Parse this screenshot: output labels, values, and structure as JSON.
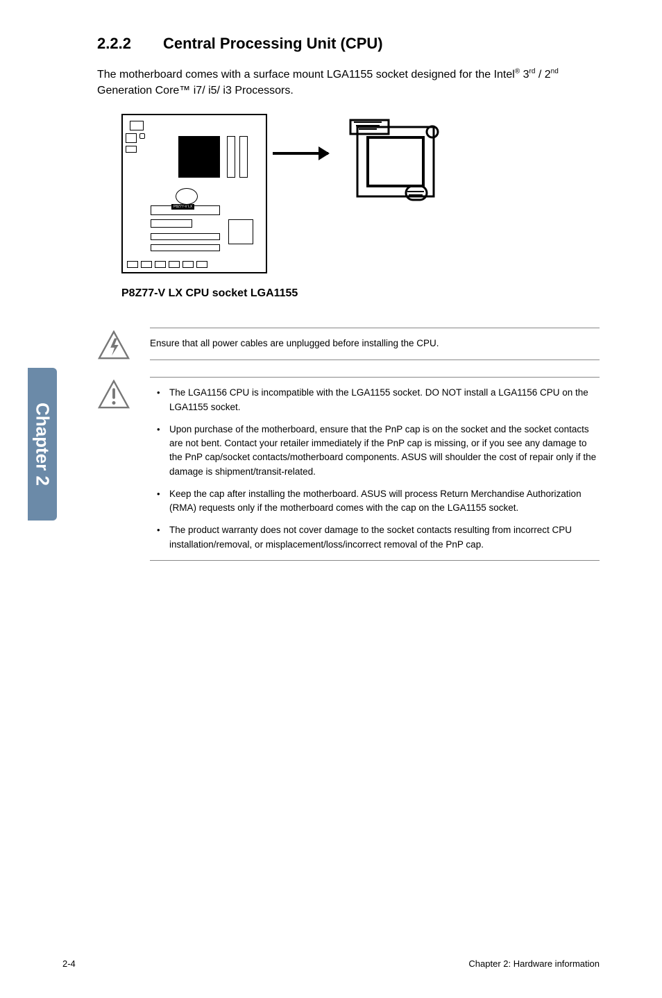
{
  "heading": {
    "number": "2.2.2",
    "title": "Central Processing Unit (CPU)"
  },
  "intro": {
    "line1a": "The motherboard comes with a surface mount LGA1155 socket designed for the Intel",
    "reg": "®",
    "line1b": " 3",
    "sup1": "rd",
    "line1c": " / 2",
    "sup2": "nd",
    "line1d": " Generation Core™ i7/ i5/ i3 Processors."
  },
  "diagram": {
    "board_label": "P8Z77-V LX",
    "caption": "P8Z77-V LX CPU socket LGA1155"
  },
  "tab": "Chapter 2",
  "warn": {
    "text": "Ensure that all power cables are unplugged before installing the CPU."
  },
  "caution": {
    "bullets": [
      "The LGA1156 CPU is incompatible with the LGA1155 socket. DO NOT install a LGA1156 CPU on the LGA1155 socket.",
      "Upon purchase of the motherboard, ensure that the PnP cap is on the socket and the socket contacts are not bent. Contact your retailer immediately if the PnP cap is missing, or if you see any damage to the PnP cap/socket contacts/motherboard components. ASUS will shoulder the cost of repair only if the damage is shipment/transit-related.",
      "Keep the cap after installing the motherboard. ASUS will process Return Merchandise Authorization (RMA) requests only if the motherboard comes with the cap on the LGA1155 socket.",
      "The product warranty does not cover damage to the socket contacts resulting from incorrect CPU installation/removal, or misplacement/loss/incorrect removal of the PnP cap."
    ]
  },
  "footer": {
    "left": "2-4",
    "right": "Chapter 2: Hardware information"
  }
}
